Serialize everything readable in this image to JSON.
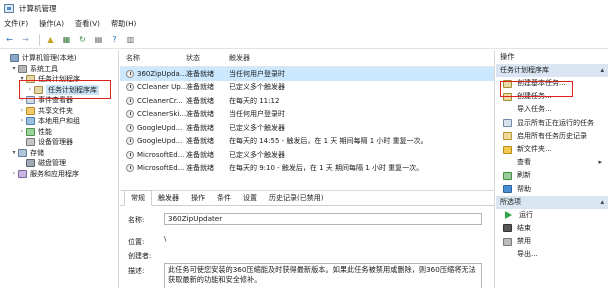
{
  "window": {
    "title": "计算机管理"
  },
  "menu": [
    "文件(F)",
    "操作(A)",
    "查看(V)",
    "帮助(H)"
  ],
  "toolbar": [
    {
      "name": "back-icon",
      "glyph": "←"
    },
    {
      "name": "forward-icon",
      "glyph": "→"
    },
    {
      "name": "up-folder-icon",
      "glyph": "▲"
    },
    {
      "name": "show-tree-icon",
      "glyph": "▦"
    },
    {
      "name": "refresh-icon",
      "glyph": "↻"
    },
    {
      "name": "properties-icon",
      "glyph": "▤"
    },
    {
      "name": "help-icon",
      "glyph": "?"
    },
    {
      "name": "view-icon",
      "glyph": "▥"
    }
  ],
  "tree": {
    "items": [
      {
        "label": "计算机管理(本地)",
        "indent": 0,
        "exp": "",
        "icon": "computer"
      },
      {
        "label": "系统工具",
        "indent": 1,
        "exp": "▾",
        "icon": "tools"
      },
      {
        "label": "任务计划程序",
        "indent": 2,
        "exp": "▾",
        "icon": "sched"
      },
      {
        "label": "任务计划程序库",
        "indent": 3,
        "exp": "›",
        "icon": "sched",
        "selected": true
      },
      {
        "label": "事件查看器",
        "indent": 2,
        "exp": "›",
        "icon": "event"
      },
      {
        "label": "共享文件夹",
        "indent": 2,
        "exp": "›",
        "icon": "share"
      },
      {
        "label": "本地用户和组",
        "indent": 2,
        "exp": "›",
        "icon": "user"
      },
      {
        "label": "性能",
        "indent": 2,
        "exp": "›",
        "icon": "perf"
      },
      {
        "label": "设备管理器",
        "indent": 2,
        "exp": "",
        "icon": "dev"
      },
      {
        "label": "存储",
        "indent": 1,
        "exp": "▾",
        "icon": "store"
      },
      {
        "label": "磁盘管理",
        "indent": 2,
        "exp": "",
        "icon": "disk"
      },
      {
        "label": "服务和应用程序",
        "indent": 1,
        "exp": "›",
        "icon": "svc"
      }
    ]
  },
  "tasks": {
    "headers": {
      "name": "名称",
      "status": "状态",
      "trigger": "触发器"
    },
    "rows": [
      {
        "name": "360ZipUpda...",
        "status": "准备就绪",
        "trigger": "当任何用户登录时",
        "selected": true
      },
      {
        "name": "CCleaner Up...",
        "status": "准备就绪",
        "trigger": "已定义多个触发器"
      },
      {
        "name": "CCleanerCr...",
        "status": "准备就绪",
        "trigger": "在每天的 11:12"
      },
      {
        "name": "CCleanerSki...",
        "status": "准备就绪",
        "trigger": "当任何用户登录时"
      },
      {
        "name": "GoogleUpd...",
        "status": "准备就绪",
        "trigger": "已定义多个触发器"
      },
      {
        "name": "GoogleUpd...",
        "status": "准备就绪",
        "trigger": "在每天的 14:55 - 触发后，在 1 天 期间每隔 1 小时 重复一次。"
      },
      {
        "name": "MicrosoftEd...",
        "status": "准备就绪",
        "trigger": "已定义多个触发器"
      },
      {
        "name": "MicrosoftEd...",
        "status": "准备就绪",
        "trigger": "在每天的 9:10 - 触发后，在 1 天 期间每隔 1 小时 重复一次。"
      }
    ]
  },
  "detail": {
    "tabs": [
      "常规",
      "触发器",
      "操作",
      "条件",
      "设置",
      "历史记录(已禁用)"
    ],
    "name_label": "名称:",
    "name_value": "360ZipUpdater",
    "location_label": "位置:",
    "location_value": "\\",
    "author_label": "创建者:",
    "desc_label": "描述:",
    "desc_value": "此任务可使您安装的360压缩能及时获得最新版本。如果此任务被禁用或删除，则360压缩将无法获取最新的功能和安全修补。"
  },
  "actions": {
    "head": "操作",
    "section1": "任务计划程序库",
    "items1": [
      {
        "label": "创建基本任务...",
        "icon": "basic"
      },
      {
        "label": "创建任务...",
        "icon": "create"
      },
      {
        "label": "导入任务...",
        "icon": "none"
      },
      {
        "label": "显示所有正在运行的任务",
        "icon": "show"
      },
      {
        "label": "启用所有任务历史记录",
        "icon": "hist"
      },
      {
        "label": "新文件夹...",
        "icon": "folder"
      },
      {
        "label": "查看",
        "icon": "none",
        "arrow": true
      },
      {
        "label": "刷新",
        "icon": "refresh"
      },
      {
        "label": "帮助",
        "icon": "help"
      }
    ],
    "section2": "所选项",
    "items2": [
      {
        "label": "运行",
        "icon": "run"
      },
      {
        "label": "结束",
        "icon": "end"
      },
      {
        "label": "禁用",
        "icon": "disable"
      },
      {
        "label": "导出...",
        "icon": "none"
      }
    ],
    "section_arrow": "▴",
    "view_arrow": "▸"
  }
}
